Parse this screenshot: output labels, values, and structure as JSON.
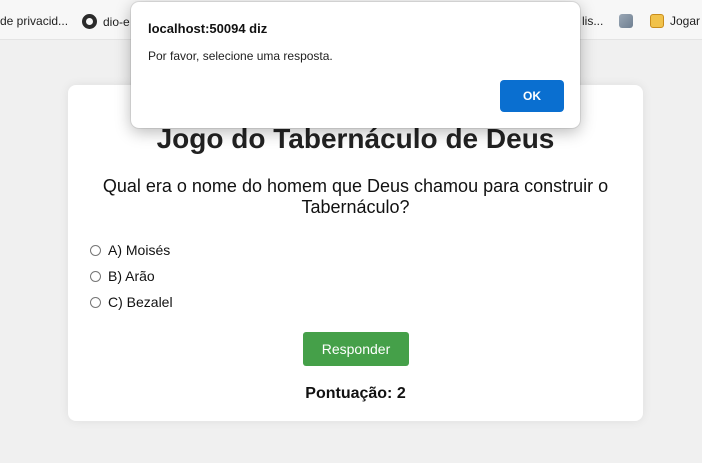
{
  "bookmarks": {
    "items": [
      {
        "label": "de privacid...",
        "icon": "none"
      },
      {
        "label": "dio-e",
        "icon": "github-icon"
      },
      {
        "label": "lis...",
        "icon": "none"
      },
      {
        "label": "",
        "icon": "image-icon"
      },
      {
        "label": "Jogar",
        "icon": "game-icon"
      }
    ]
  },
  "page": {
    "title": "Jogo do Tabernáculo de Deus",
    "question": "Qual era o nome do homem que Deus chamou para construir o Tabernáculo?",
    "options": [
      "A) Moisés",
      "B) Arão",
      "C) Bezalel"
    ],
    "submit_label": "Responder",
    "score_text": "Pontuação: 2"
  },
  "dialog": {
    "title": "localhost:50094 diz",
    "message": "Por favor, selecione uma resposta.",
    "ok_label": "OK"
  },
  "colors": {
    "accent_button": "#45a049",
    "dialog_ok": "#0a6fd0",
    "background": "#f0f0f0"
  }
}
